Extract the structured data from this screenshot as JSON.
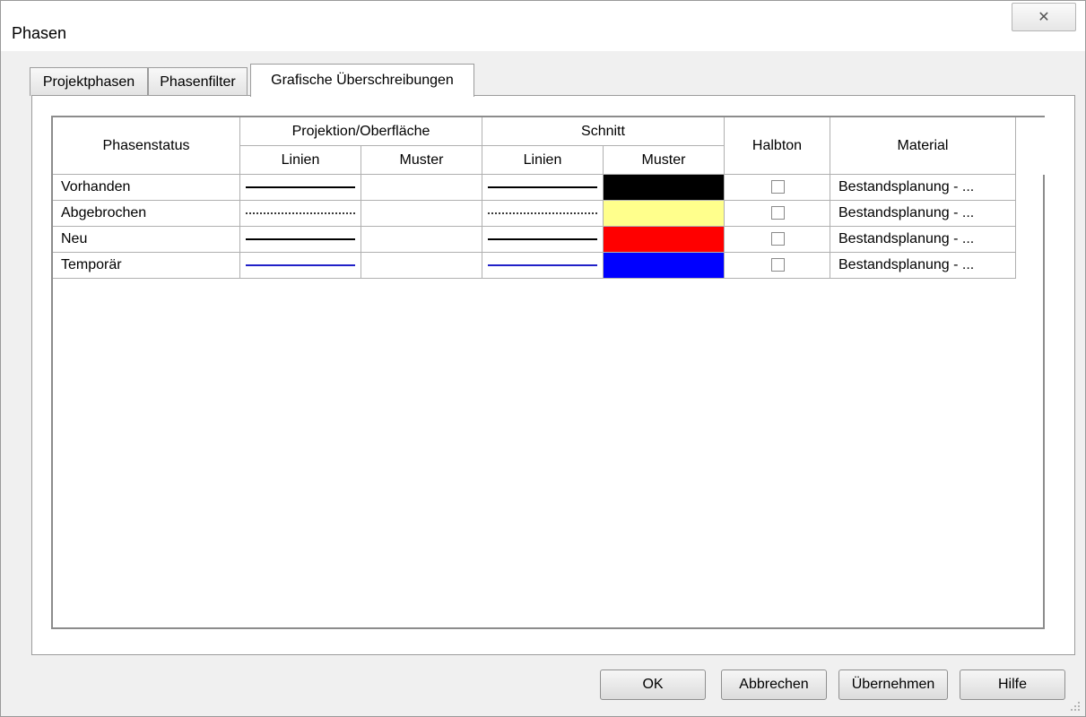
{
  "window": {
    "title": "Phasen",
    "close_glyph": "✕"
  },
  "tabs": [
    {
      "label": "Projektphasen",
      "active": false
    },
    {
      "label": "Phasenfilter",
      "active": false
    },
    {
      "label": "Grafische Überschreibungen",
      "active": true
    }
  ],
  "table": {
    "headers": {
      "phasenstatus": "Phasenstatus",
      "projektion_group": "Projektion/Oberfläche",
      "schnitt_group": "Schnitt",
      "linien": "Linien",
      "muster": "Muster",
      "halbton": "Halbton",
      "material": "Material"
    },
    "rows": [
      {
        "status": "Vorhanden",
        "proj_linien": "solid-black",
        "proj_muster": "",
        "schnitt_linien": "solid-black",
        "schnitt_muster_color": "#000000",
        "halbton": false,
        "material": "Bestandsplanung - ..."
      },
      {
        "status": "Abgebrochen",
        "proj_linien": "dotted-black",
        "proj_muster": "",
        "schnitt_linien": "dotted-black",
        "schnitt_muster_color": "#ffff8c",
        "halbton": false,
        "material": "Bestandsplanung - ..."
      },
      {
        "status": "Neu",
        "proj_linien": "solid-black",
        "proj_muster": "",
        "schnitt_linien": "solid-black",
        "schnitt_muster_color": "#ff0000",
        "halbton": false,
        "material": "Bestandsplanung - ..."
      },
      {
        "status": "Temporär",
        "proj_linien": "solid-blue",
        "proj_muster": "",
        "schnitt_linien": "solid-blue",
        "schnitt_muster_color": "#0000ff",
        "halbton": false,
        "material": "Bestandsplanung - ..."
      }
    ]
  },
  "buttons": {
    "ok": "OK",
    "abbrechen": "Abbrechen",
    "uebernehmen": "Übernehmen",
    "hilfe": "Hilfe"
  }
}
